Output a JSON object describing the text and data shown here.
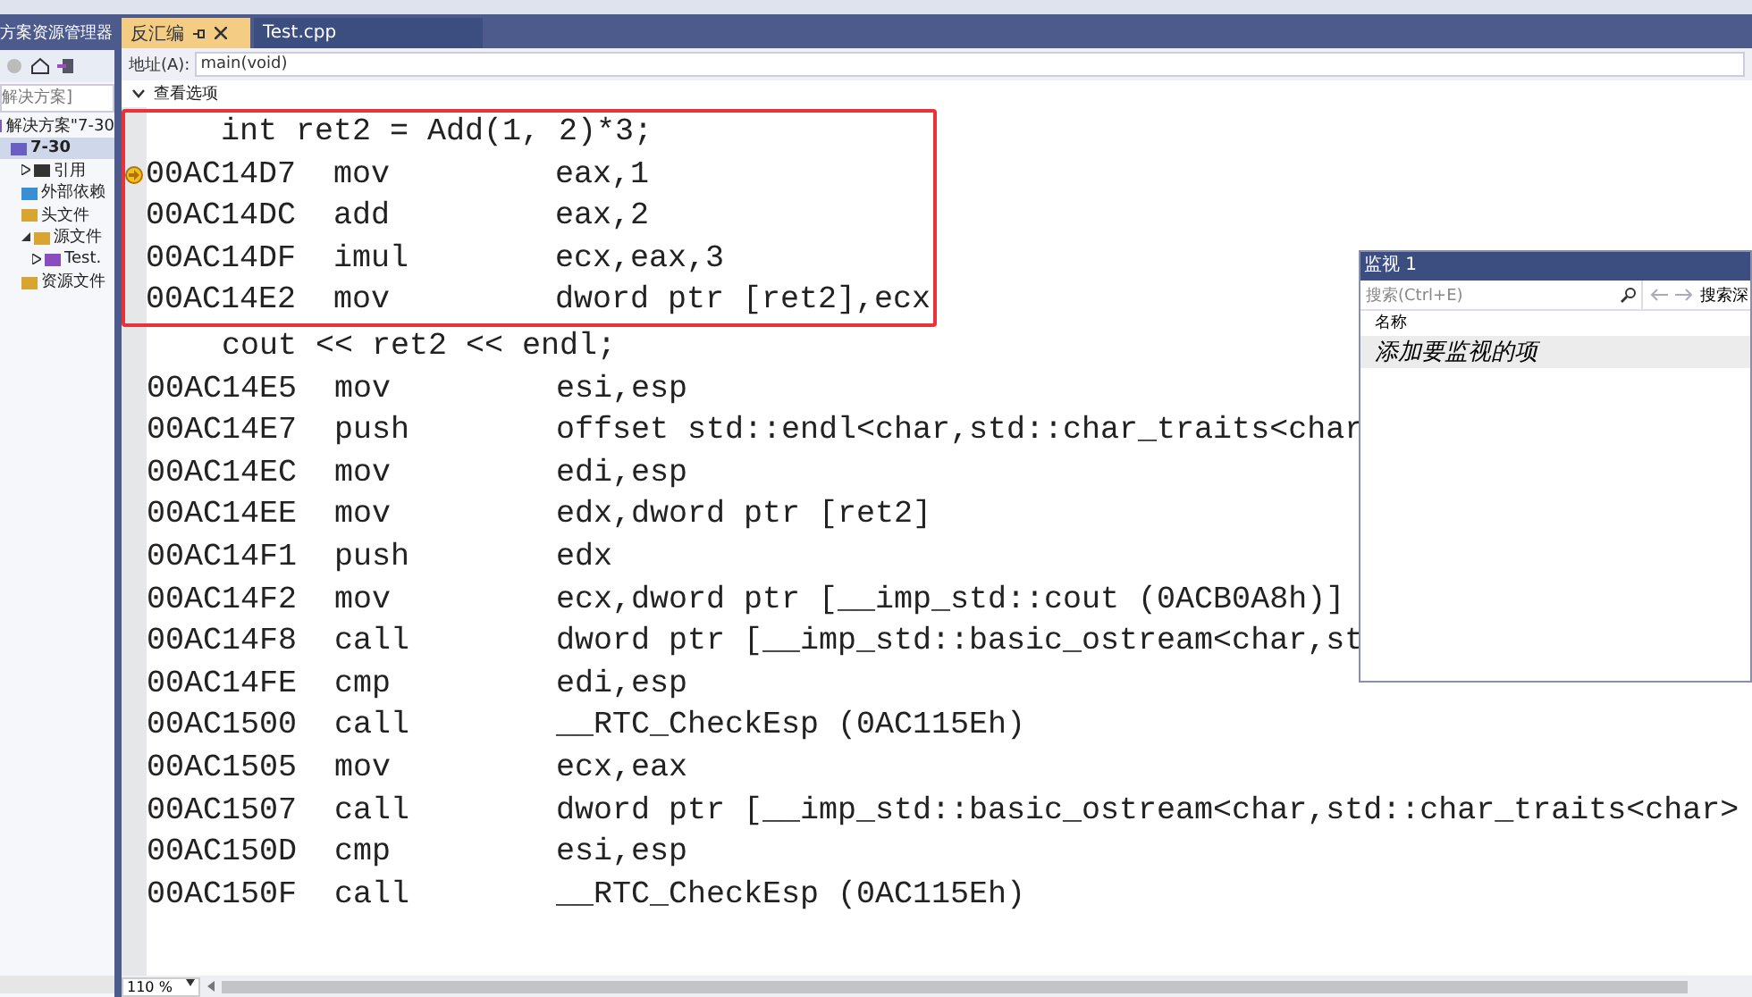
{
  "sidebar": {
    "title": "方案资源管理器",
    "search": {
      "placeholder": "解决方案]"
    },
    "tree": [
      {
        "label": "解决方案\"7-30",
        "kind": "solution",
        "selected": false,
        "bold": false,
        "children": [
          {
            "label": "7-30",
            "kind": "project",
            "selected": true,
            "bold": true,
            "children": [
              {
                "label": "引用",
                "kind": "refs",
                "selected": false,
                "bold": false,
                "expanded": false
              },
              {
                "label": "外部依赖",
                "kind": "ext",
                "selected": false,
                "bold": false
              },
              {
                "label": "头文件",
                "kind": "folder",
                "selected": false,
                "bold": false
              },
              {
                "label": "源文件",
                "kind": "folder",
                "selected": false,
                "bold": false,
                "expanded": true,
                "children": [
                  {
                    "label": "Test.",
                    "kind": "cpp",
                    "selected": false,
                    "bold": false,
                    "expanded": false
                  }
                ]
              },
              {
                "label": "资源文件",
                "kind": "folder",
                "selected": false,
                "bold": false
              }
            ]
          }
        ]
      }
    ]
  },
  "tabs": [
    {
      "label": "反汇编",
      "selected": true,
      "pinned": true
    },
    {
      "label": "Test.cpp",
      "selected": false,
      "pinned": false
    }
  ],
  "address": {
    "label": "地址(A):",
    "value": "main(void)"
  },
  "view_options": {
    "label": "查看选项",
    "expanded": true
  },
  "code": [
    {
      "kind": "source",
      "text": "int ret2 = Add(1, 2)*3;",
      "boxed": true
    },
    {
      "kind": "asm",
      "address": "00AC14D7",
      "op": "mov",
      "operands": "eax,1",
      "boxed": true,
      "current": true
    },
    {
      "kind": "asm",
      "address": "00AC14DC",
      "op": "add",
      "operands": "eax,2",
      "boxed": true
    },
    {
      "kind": "asm",
      "address": "00AC14DF",
      "op": "imul",
      "operands": "ecx,eax,3",
      "boxed": true
    },
    {
      "kind": "asm",
      "address": "00AC14E2",
      "op": "mov",
      "operands": "dword ptr [ret2],ecx",
      "boxed": true
    },
    {
      "kind": "source",
      "text": "cout << ret2 << endl;",
      "boxed": false
    },
    {
      "kind": "asm",
      "address": "00AC14E5",
      "op": "mov",
      "operands": "esi,esp",
      "boxed": false
    },
    {
      "kind": "asm",
      "address": "00AC14E7",
      "op": "push",
      "operands": "offset std::endl<char,std::char_traits<char",
      "boxed": false
    },
    {
      "kind": "asm",
      "address": "00AC14EC",
      "op": "mov",
      "operands": "edi,esp",
      "boxed": false
    },
    {
      "kind": "asm",
      "address": "00AC14EE",
      "op": "mov",
      "operands": "edx,dword ptr [ret2]",
      "boxed": false
    },
    {
      "kind": "asm",
      "address": "00AC14F1",
      "op": "push",
      "operands": "edx",
      "boxed": false
    },
    {
      "kind": "asm",
      "address": "00AC14F2",
      "op": "mov",
      "operands": "ecx,dword ptr [__imp_std::cout (0ACB0A8h)]",
      "boxed": false
    },
    {
      "kind": "asm",
      "address": "00AC14F8",
      "op": "call",
      "operands": "dword ptr [__imp_std::basic_ostream<char,st",
      "boxed": false
    },
    {
      "kind": "asm",
      "address": "00AC14FE",
      "op": "cmp",
      "operands": "edi,esp",
      "boxed": false
    },
    {
      "kind": "asm",
      "address": "00AC1500",
      "op": "call",
      "operands": "__RTC_CheckEsp (0AC115Eh)",
      "boxed": false
    },
    {
      "kind": "asm",
      "address": "00AC1505",
      "op": "mov",
      "operands": "ecx,eax",
      "boxed": false
    },
    {
      "kind": "asm",
      "address": "00AC1507",
      "op": "call",
      "operands": "dword ptr [__imp_std::basic_ostream<char,std::char_traits<char>",
      "boxed": false
    },
    {
      "kind": "asm",
      "address": "00AC150D",
      "op": "cmp",
      "operands": "esi,esp",
      "boxed": false
    },
    {
      "kind": "asm",
      "address": "00AC150F",
      "op": "call",
      "operands": "__RTC_CheckEsp (0AC115Eh)",
      "boxed": false
    }
  ],
  "zoom": "110 %",
  "watch": {
    "title": "监视 1",
    "search": {
      "placeholder": "搜索(Ctrl+E)"
    },
    "search_depth": "搜索深",
    "column": "名称",
    "add_hint": "添加要监视的项"
  }
}
